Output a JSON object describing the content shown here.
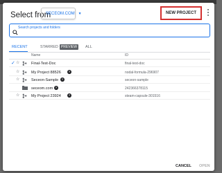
{
  "dialog": {
    "title": "Select from",
    "org_select": "SECEOM.COM",
    "new_project_label": "NEW PROJECT"
  },
  "search": {
    "label": "Search projects and folders",
    "value": ""
  },
  "tabs": [
    {
      "label": "RECENT",
      "active": true
    },
    {
      "label": "STARRED",
      "badge": "PREVIEW",
      "active": false
    },
    {
      "label": "ALL",
      "active": false
    }
  ],
  "table": {
    "columns": [
      "Name",
      "ID"
    ],
    "rows": [
      {
        "name": "Final-Test-Doc",
        "id": "final-test-doc",
        "selected": true,
        "type": "project",
        "help": false
      },
      {
        "name": "My Project 88526",
        "id": "nodal-formula-296907",
        "selected": false,
        "type": "project",
        "help": true
      },
      {
        "name": "Seceon-Sample",
        "id": "seceon-sample",
        "selected": false,
        "type": "project",
        "help": true
      },
      {
        "name": "seceom.com",
        "id": "242366378115",
        "selected": false,
        "type": "organization",
        "help": true
      },
      {
        "name": "My Project 23924",
        "id": "steam-capsule-301516",
        "selected": false,
        "type": "project",
        "help": true
      }
    ]
  },
  "footer": {
    "cancel_label": "CANCEL",
    "open_label": "OPEN"
  },
  "colors": {
    "accent": "#1a73e8",
    "highlight_border": "#d32f2f"
  }
}
